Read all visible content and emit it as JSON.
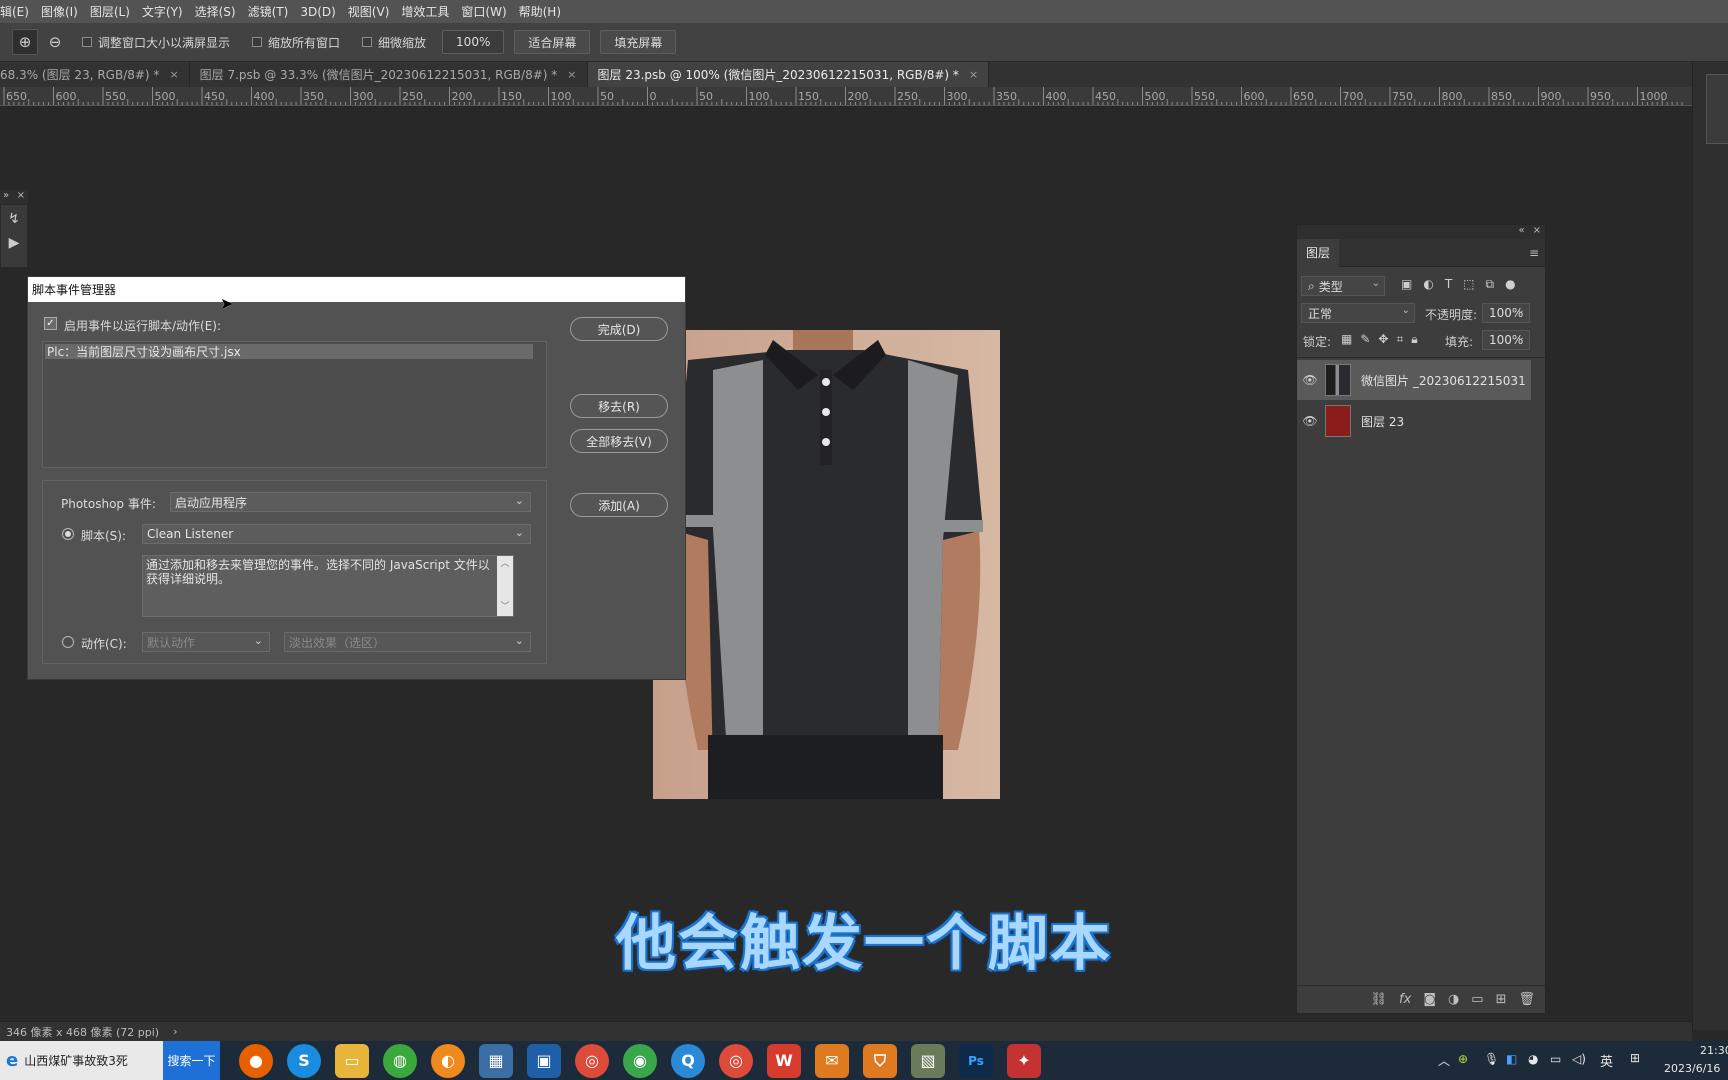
{
  "menubar": [
    "辑(E)",
    "图像(I)",
    "图层(L)",
    "文字(Y)",
    "选择(S)",
    "滤镜(T)",
    "3D(D)",
    "视图(V)",
    "增效工具",
    "窗口(W)",
    "帮助(H)"
  ],
  "options": {
    "resize_windows": "调整窗口大小以满屏显示",
    "zoom_all": "缩放所有窗口",
    "scrubby": "细微缩放",
    "zoom_value": "100%",
    "fit_screen": "适合屏幕",
    "fill_screen": "填充屏幕"
  },
  "tabs": [
    {
      "label": "68.3% (图层 23, RGB/8#) *",
      "active": false
    },
    {
      "label": "图层 7.psb @ 33.3% (微信图片_20230612215031, RGB/8#) *",
      "active": false
    },
    {
      "label": "图层 23.psb @ 100% (微信图片_20230612215031, RGB/8#) *",
      "active": true
    }
  ],
  "ruler_ticks": [
    "650",
    "600",
    "550",
    "500",
    "450",
    "400",
    "350",
    "300",
    "250",
    "200",
    "150",
    "100",
    "50",
    "0",
    "50",
    "100",
    "150",
    "200",
    "250",
    "300",
    "350",
    "400",
    "450",
    "500",
    "550",
    "600",
    "650",
    "700",
    "750",
    "800",
    "850",
    "900",
    "950",
    "1000"
  ],
  "dialog": {
    "title": "脚本事件管理器",
    "enable_label": "启用事件以运行脚本/动作(E):",
    "list_item": "Plc：当前图层尺寸设为画布尺寸.jsx",
    "done": "完成(D)",
    "remove": "移去(R)",
    "remove_all": "全部移去(V)",
    "add": "添加(A)",
    "event_label": "Photoshop 事件:",
    "event_value": "启动应用程序",
    "script_label": "脚本(S):",
    "script_value": "Clean Listener",
    "description": "通过添加和移去来管理您的事件。选择不同的 JavaScript 文件以获得详细说明。",
    "action_label": "动作(C):",
    "action_set": "默认动作",
    "action_name": "淡出效果（选区）"
  },
  "layers_panel": {
    "title": "图层",
    "filter_type": "类型",
    "blend_mode": "正常",
    "opacity_label": "不透明度:",
    "opacity_value": "100%",
    "lock_label": "锁定:",
    "fill_label": "填充:",
    "fill_value": "100%",
    "layers": [
      {
        "name": "微信图片 _20230612215031",
        "color": "#2b2b2b"
      },
      {
        "name": "图层 23",
        "color": "#8a1c1c"
      }
    ]
  },
  "subtitle": "他会触发一个脚本",
  "status": "346 像素 x 468 像素 (72 ppi)",
  "taskbar": {
    "search_text": "山西煤矿事故致3死",
    "search_button": "搜索一下",
    "input_lang": "英",
    "time": "21:30",
    "date": "2023/6/16"
  },
  "colors": {
    "accent": "#1e6fd6",
    "subtitle_fill": "#a8d8ff",
    "subtitle_outline": "#1f6fc9",
    "layer23_fill": "#8a1c1c"
  }
}
